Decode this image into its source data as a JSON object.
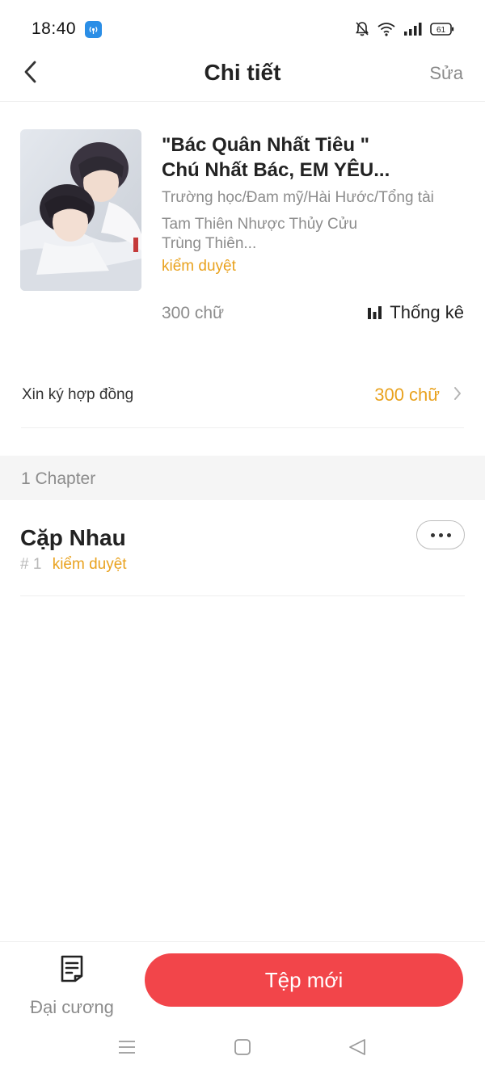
{
  "status_bar": {
    "time": "18:40",
    "battery": "61",
    "icons": [
      "hotspot-icon",
      "bell-off-icon",
      "wifi-icon",
      "signal-icon",
      "battery-icon"
    ]
  },
  "header": {
    "title": "Chi tiết",
    "edit_label": "Sửa"
  },
  "book": {
    "title_line1": "\"Bác Quân Nhất Tiêu \"",
    "title_line2": "Chú Nhất Bác, EM YÊU...",
    "genres": "Trường học/Đam mỹ/Hài Hước/Tổng tài",
    "author": "Tam Thiên Nhược Thủy Cửu Trùng Thiên...",
    "status": "kiểm duyệt",
    "word_count": "300 chữ",
    "stats_label": "Thống kê"
  },
  "contract": {
    "label": "Xin ký hợp đồng",
    "value": "300 chữ"
  },
  "chapters": {
    "count_label": "1 Chapter",
    "items": [
      {
        "title": "Cặp Nhau",
        "number": "# 1",
        "status": "kiểm duyệt"
      }
    ]
  },
  "bottom_bar": {
    "outline_label": "Đại cương",
    "new_file_label": "Tệp mới"
  },
  "colors": {
    "accent_orange": "#e9a21e",
    "primary_red": "#f2454a",
    "muted_gray": "#8c8c8c"
  }
}
